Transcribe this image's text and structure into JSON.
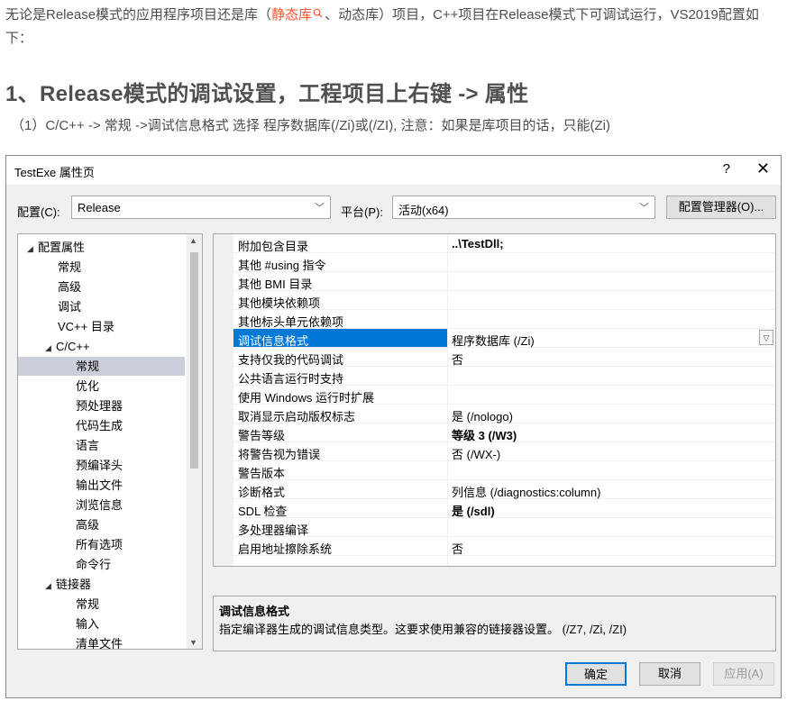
{
  "article": {
    "intro_a": "无论是Release模式的应用程序项目还是库（",
    "intro_link": "静态库",
    "intro_b": "、动态库）项目，C++项目在Release模式下可调试运行，VS2019配置如下：",
    "heading": "1、Release模式的调试设置，工程项目上右键 -> 属性",
    "step": "（1）C/C++ -> 常规 ->调试信息格式 选择 程序数据库(/Zi)或(/ZI), 注意：如果是库项目的话，只能(Zi)",
    "link_color": "#fc5531"
  },
  "dialog": {
    "title": "TestExe 属性页",
    "help": "?",
    "close": "✕",
    "config_label": "配置(C):",
    "config_value": "Release",
    "platform_label": "平台(P):",
    "platform_value": "活动(x64)",
    "config_manager": "配置管理器(O)...",
    "tree": [
      {
        "label": "配置属性",
        "level": 0,
        "expanded": true
      },
      {
        "label": "常规",
        "level": 1
      },
      {
        "label": "高级",
        "level": 1
      },
      {
        "label": "调试",
        "level": 1
      },
      {
        "label": "VC++ 目录",
        "level": 1
      },
      {
        "label": "C/C++",
        "level": 1,
        "expanded": true
      },
      {
        "label": "常规",
        "level": 2,
        "selected": true
      },
      {
        "label": "优化",
        "level": 2
      },
      {
        "label": "预处理器",
        "level": 2
      },
      {
        "label": "代码生成",
        "level": 2
      },
      {
        "label": "语言",
        "level": 2
      },
      {
        "label": "预编译头",
        "level": 2
      },
      {
        "label": "输出文件",
        "level": 2
      },
      {
        "label": "浏览信息",
        "level": 2
      },
      {
        "label": "高级",
        "level": 2
      },
      {
        "label": "所有选项",
        "level": 2
      },
      {
        "label": "命令行",
        "level": 2
      },
      {
        "label": "链接器",
        "level": 1,
        "expanded": true
      },
      {
        "label": "常规",
        "level": 2
      },
      {
        "label": "输入",
        "level": 2
      },
      {
        "label": "清单文件",
        "level": 2
      }
    ],
    "properties": [
      {
        "name": "附加包含目录",
        "value": "..\\TestDll;",
        "bold": true
      },
      {
        "name": "其他 #using 指令",
        "value": ""
      },
      {
        "name": "其他 BMI 目录",
        "value": ""
      },
      {
        "name": "其他模块依赖项",
        "value": ""
      },
      {
        "name": "其他标头单元依赖项",
        "value": ""
      },
      {
        "name": "调试信息格式",
        "value": "程序数据库 (/Zi)",
        "highlight": true
      },
      {
        "name": "支持仅我的代码调试",
        "value": "否"
      },
      {
        "name": "公共语言运行时支持",
        "value": ""
      },
      {
        "name": "使用 Windows 运行时扩展",
        "value": ""
      },
      {
        "name": "取消显示启动版权标志",
        "value": "是 (/nologo)"
      },
      {
        "name": "警告等级",
        "value": "等级 3 (/W3)",
        "bold": true
      },
      {
        "name": "将警告视为错误",
        "value": "否 (/WX-)"
      },
      {
        "name": "警告版本",
        "value": ""
      },
      {
        "name": "诊断格式",
        "value": "列信息 (/diagnostics:column)"
      },
      {
        "name": "SDL 检查",
        "value": "是 (/sdl)",
        "bold": true
      },
      {
        "name": "多处理器编译",
        "value": ""
      },
      {
        "name": "启用地址擦除系统",
        "value": "否"
      }
    ],
    "desc_title": "调试信息格式",
    "desc_text": "指定编译器生成的调试信息类型。这要求使用兼容的链接器设置。 (/Z7, /Zi, /ZI)",
    "ok": "确定",
    "cancel": "取消",
    "apply": "应用(A)",
    "highlight_color": "#0078d7"
  }
}
